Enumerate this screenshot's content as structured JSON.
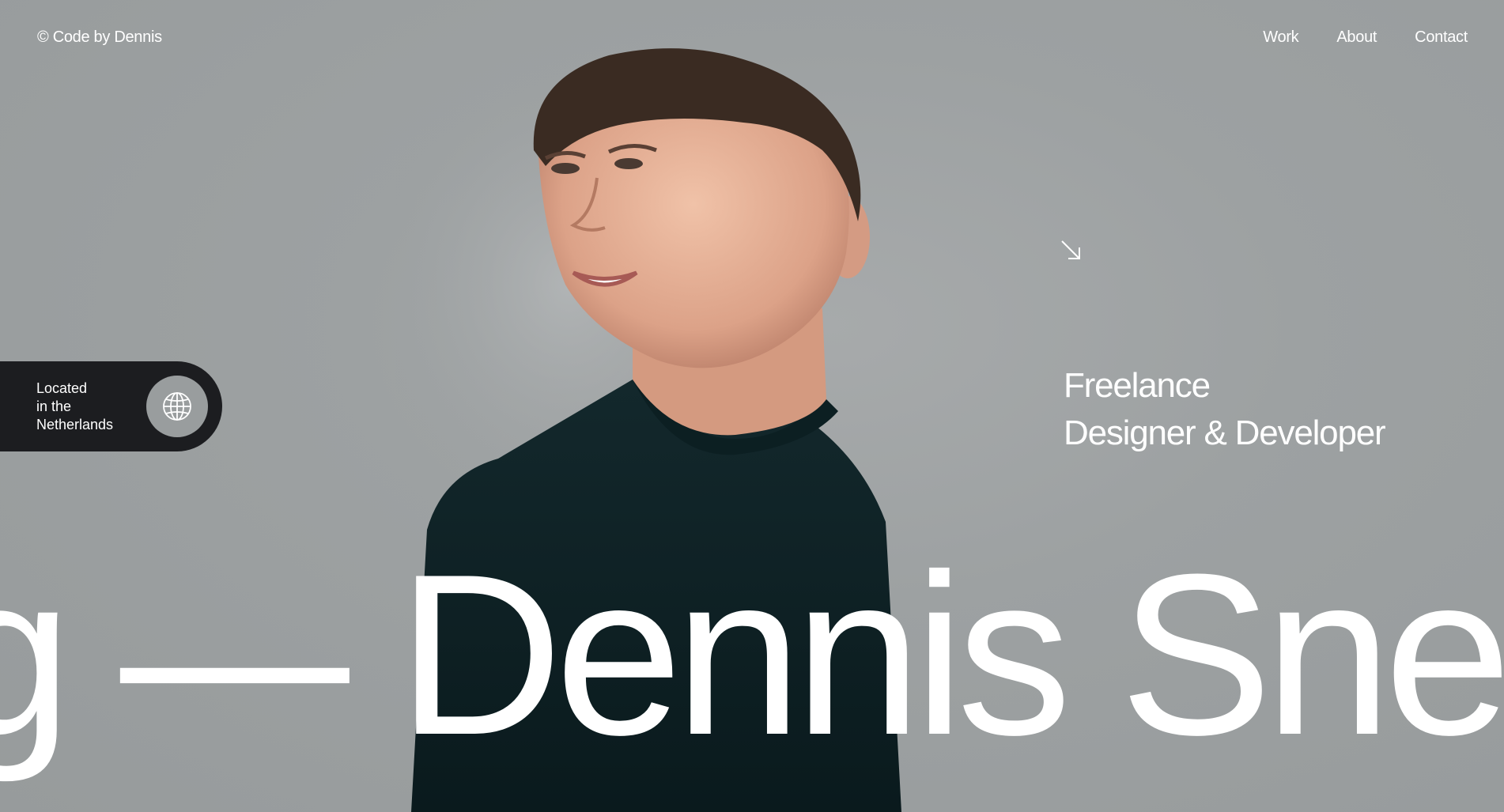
{
  "header": {
    "brand": "© Code by Dennis",
    "nav": [
      "Work",
      "About",
      "Contact"
    ]
  },
  "location": {
    "lines": [
      "Located",
      "in the",
      "Netherlands"
    ],
    "icon": "globe-icon"
  },
  "hero": {
    "arrow_icon": "arrow-down-right-icon",
    "role_lines": [
      "Freelance",
      "Designer & Developer"
    ],
    "marquee": "g — Dennis Snel"
  },
  "colors": {
    "background": "#999d9e",
    "pill": "#1c1d20",
    "text": "#ffffff",
    "sweater": "#0f2428"
  }
}
